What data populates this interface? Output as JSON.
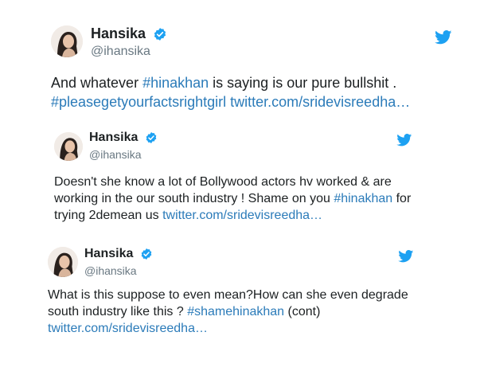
{
  "colors": {
    "link": "#2b7bb9",
    "handle": "#697882",
    "text": "#1c2022",
    "verified": "#1da1f2",
    "bird": "#1da1f2"
  },
  "icons": {
    "avatar": "avatar",
    "verified": "verified-badge-icon",
    "twitter": "twitter-bird-icon"
  },
  "tweets": [
    {
      "name": "Hansika",
      "handle": "@ihansika",
      "lines": [
        [
          {
            "text": "And whatever ",
            "link": false
          },
          {
            "text": "#hinakhan",
            "link": true
          },
          {
            "text": " is saying is our pure bullshit .",
            "link": false
          }
        ],
        [
          {
            "text": "#pleasegetyourfactsrightgirl",
            "link": true
          },
          {
            "text": " ",
            "link": false
          },
          {
            "text": "twitter.com/sridevisreedha…",
            "link": true
          }
        ]
      ]
    },
    {
      "name": "Hansika",
      "handle": "@ihansika",
      "lines": [
        [
          {
            "text": "Doesn't she know a lot of Bollywood actors hv worked & are",
            "link": false
          }
        ],
        [
          {
            "text": "working in the our south industry ! Shame on you ",
            "link": false
          },
          {
            "text": "#hinakhan",
            "link": true
          },
          {
            "text": " for",
            "link": false
          }
        ],
        [
          {
            "text": "trying 2demean us ",
            "link": false
          },
          {
            "text": "twitter.com/sridevisreedha…",
            "link": true
          }
        ]
      ]
    },
    {
      "name": "Hansika",
      "handle": "@ihansika",
      "lines": [
        [
          {
            "text": "What is this suppose to  even mean?How can she even degrade",
            "link": false
          }
        ],
        [
          {
            "text": "south industry like this ? ",
            "link": false
          },
          {
            "text": "#shamehinakhan",
            "link": true
          },
          {
            "text": " (cont)",
            "link": false
          }
        ],
        [
          {
            "text": "twitter.com/sridevisreedha…",
            "link": true
          }
        ]
      ]
    }
  ]
}
